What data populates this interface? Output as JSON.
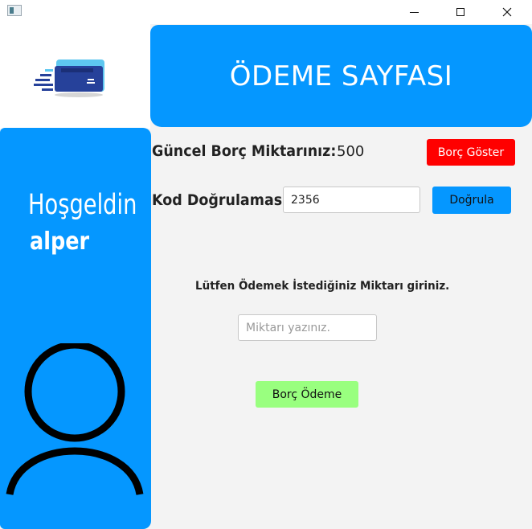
{
  "window": {
    "icon": "app-window-icon",
    "controls": [
      "minimize-icon",
      "maximize-icon",
      "close-icon"
    ]
  },
  "logo": {
    "icon": "credit-card-icon"
  },
  "header": {
    "title": "ÖDEME SAYFASI"
  },
  "sidebar": {
    "welcome": "Hoşgeldin",
    "username": "alper",
    "avatar_icon": "user-icon"
  },
  "debt": {
    "label": "Güncel Borç Miktarınız:",
    "value": "500",
    "show_button": "Borç Göster"
  },
  "verification": {
    "label": "Kod Doğrulaması:",
    "code_value": "2356",
    "verify_button": "Doğrula"
  },
  "payment": {
    "instruction": "Lütfen Ödemek İstediğiniz Miktarı giriniz.",
    "amount_placeholder": "Miktarı yazınız.",
    "pay_button": "Borç Ödeme"
  },
  "colors": {
    "primary": "#0597ff",
    "danger": "#ff0000",
    "success": "#99ff7f"
  }
}
